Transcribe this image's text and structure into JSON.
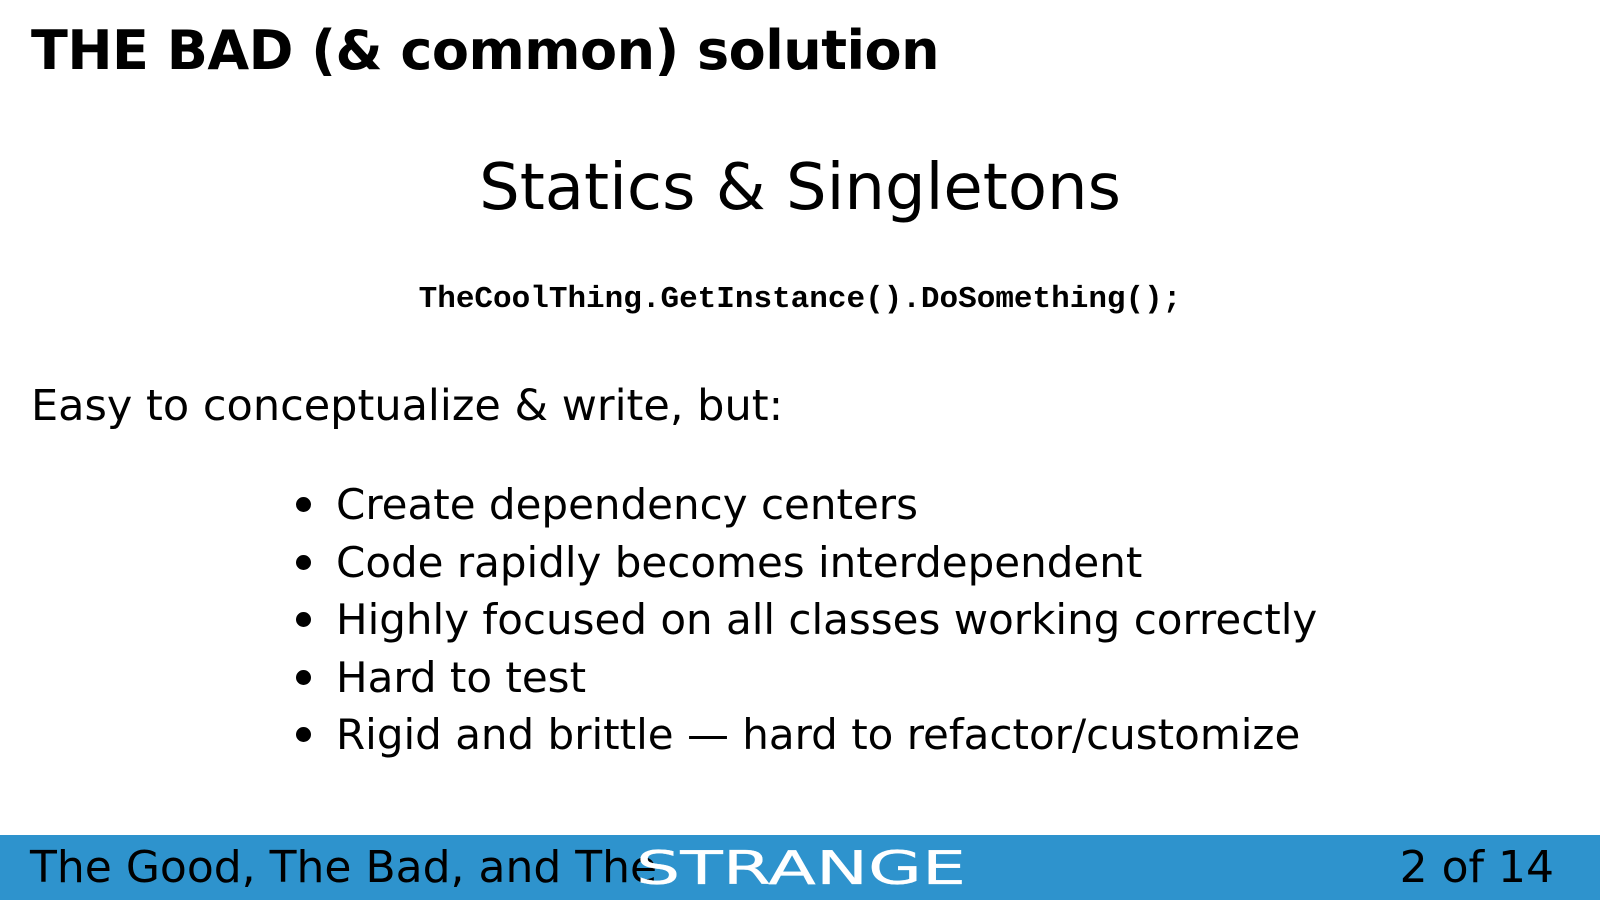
{
  "slide": {
    "title": "THE BAD (& common) solution",
    "subtitle": "Statics & Singletons",
    "code": "TheCoolThing.GetInstance().DoSomething();",
    "intro": "Easy to conceptualize & write, but:",
    "bullets": [
      "Create dependency centers",
      "Code rapidly becomes interdependent",
      "Highly focused on all classes working correctly",
      "Hard to test",
      "Rigid and brittle — hard to refactor/customize"
    ]
  },
  "footer": {
    "text": "The Good, The Bad, and The",
    "logo_text": "STRANGE",
    "page": "2 of 14",
    "background_color": "#2e93cd",
    "logo_color": "#ffffff"
  }
}
